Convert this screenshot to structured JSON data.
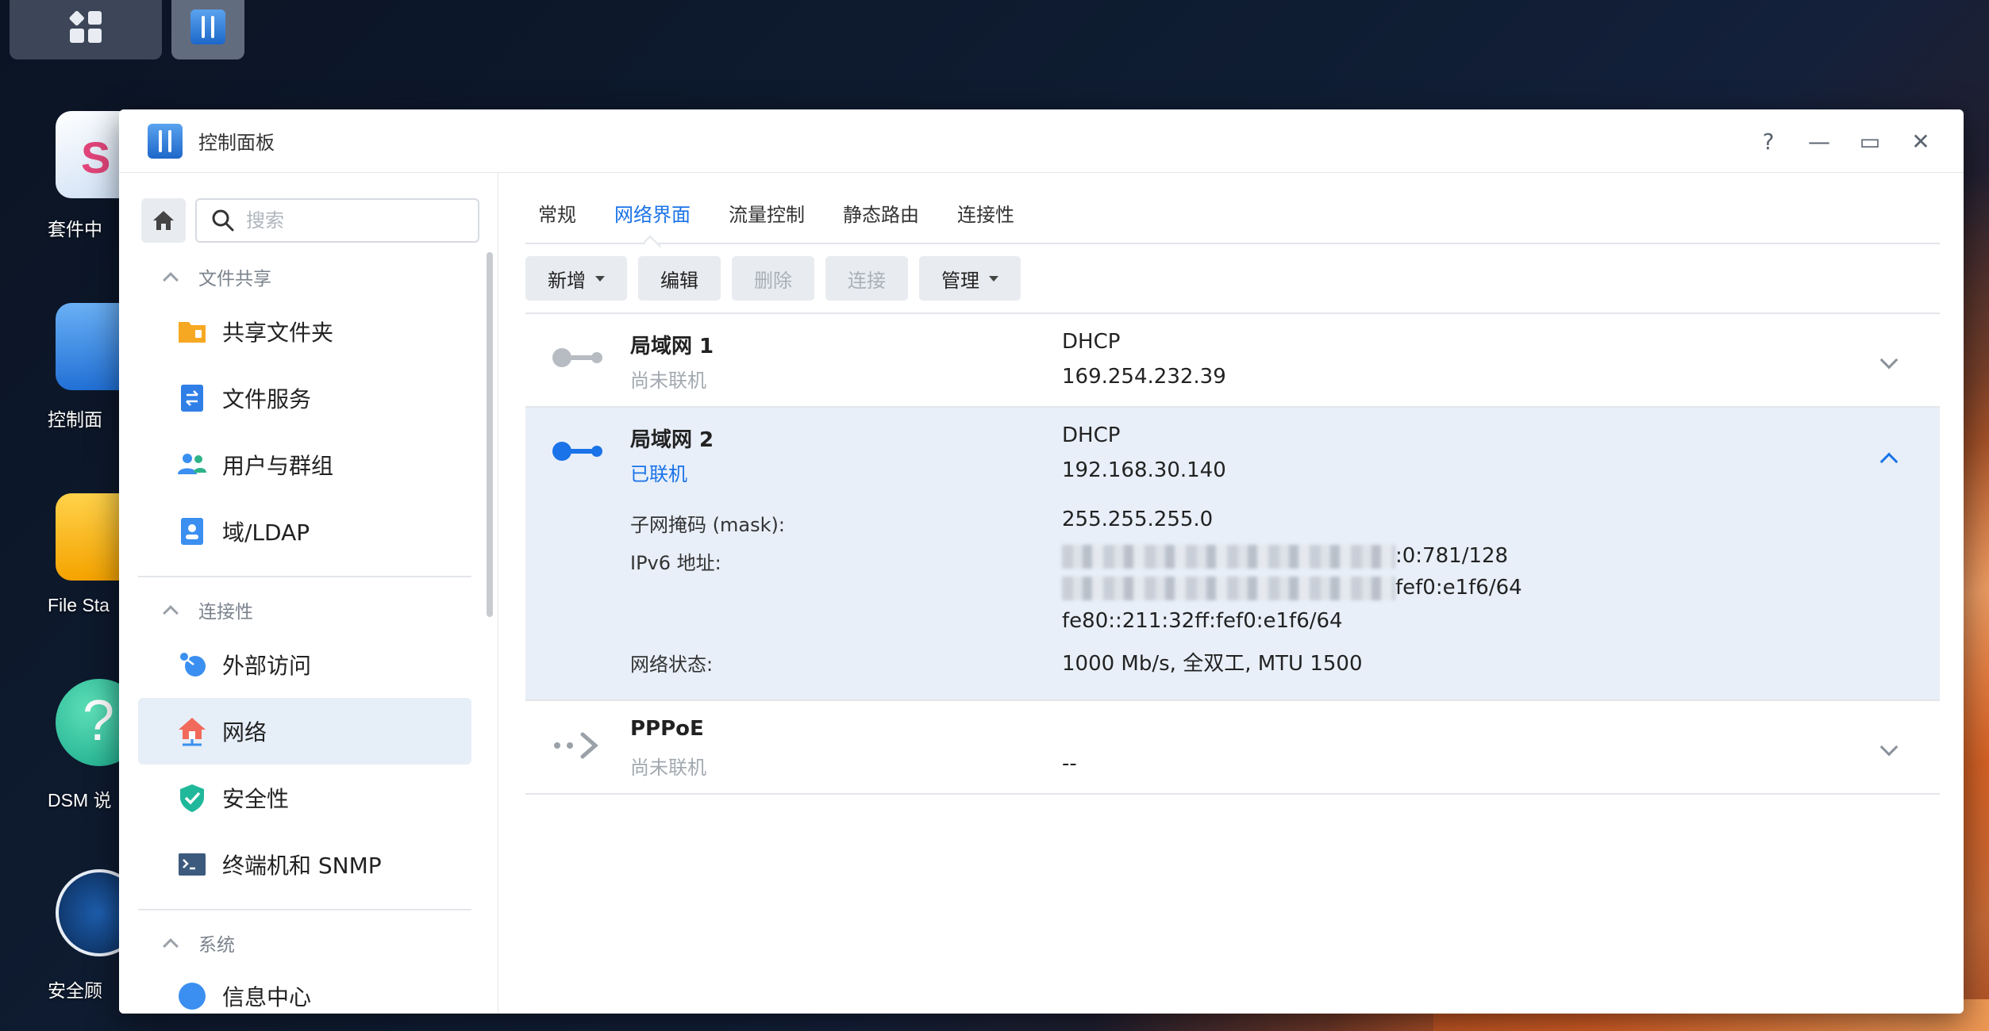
{
  "desktop": {
    "icons": [
      {
        "label": "套件中"
      },
      {
        "label": "控制面"
      },
      {
        "label": "File Sta"
      },
      {
        "label": "DSM 说"
      },
      {
        "label": "安全顾"
      }
    ]
  },
  "window": {
    "title": "控制面板",
    "controls": {
      "help": "?",
      "minimize": "—",
      "maximize": "▭",
      "close": "✕"
    }
  },
  "sidebar": {
    "search_placeholder": "搜索",
    "sections": [
      {
        "title": "文件共享",
        "items": [
          "共享文件夹",
          "文件服务",
          "用户与群组",
          "域/LDAP"
        ]
      },
      {
        "title": "连接性",
        "items": [
          "外部访问",
          "网络",
          "安全性",
          "终端机和 SNMP"
        ]
      },
      {
        "title": "系统",
        "items": [
          "信息中心"
        ]
      }
    ],
    "active_item": "网络"
  },
  "tabs": {
    "items": [
      "常规",
      "网络界面",
      "流量控制",
      "静态路由",
      "连接性"
    ],
    "active": "网络界面"
  },
  "toolbar": {
    "add": "新增",
    "edit": "编辑",
    "delete": "删除",
    "connect": "连接",
    "manage": "管理"
  },
  "interfaces": [
    {
      "name": "局域网 1",
      "status": "尚未联机",
      "type": "DHCP",
      "ip": "169.254.232.39"
    },
    {
      "name": "局域网 2",
      "status": "已联机",
      "type": "DHCP",
      "ip": "192.168.30.140",
      "details": {
        "mask_label": "子网掩码 (mask):",
        "mask": "255.255.255.0",
        "ipv6_label": "IPv6 地址:",
        "ipv6_1_suffix": ":0:781/128",
        "ipv6_2_suffix": "fef0:e1f6/64",
        "ipv6_3": "fe80::211:32ff:fef0:e1f6/64",
        "state_label": "网络状态:",
        "state": "1000 Mb/s, 全双工, MTU 1500"
      }
    },
    {
      "name": "PPPoE",
      "status": "尚未联机",
      "type": "",
      "ip": "--"
    }
  ],
  "colors": {
    "accent": "#1a73e8",
    "active_bg": "#e6eef8",
    "expanded_bg": "#e8eff9"
  }
}
